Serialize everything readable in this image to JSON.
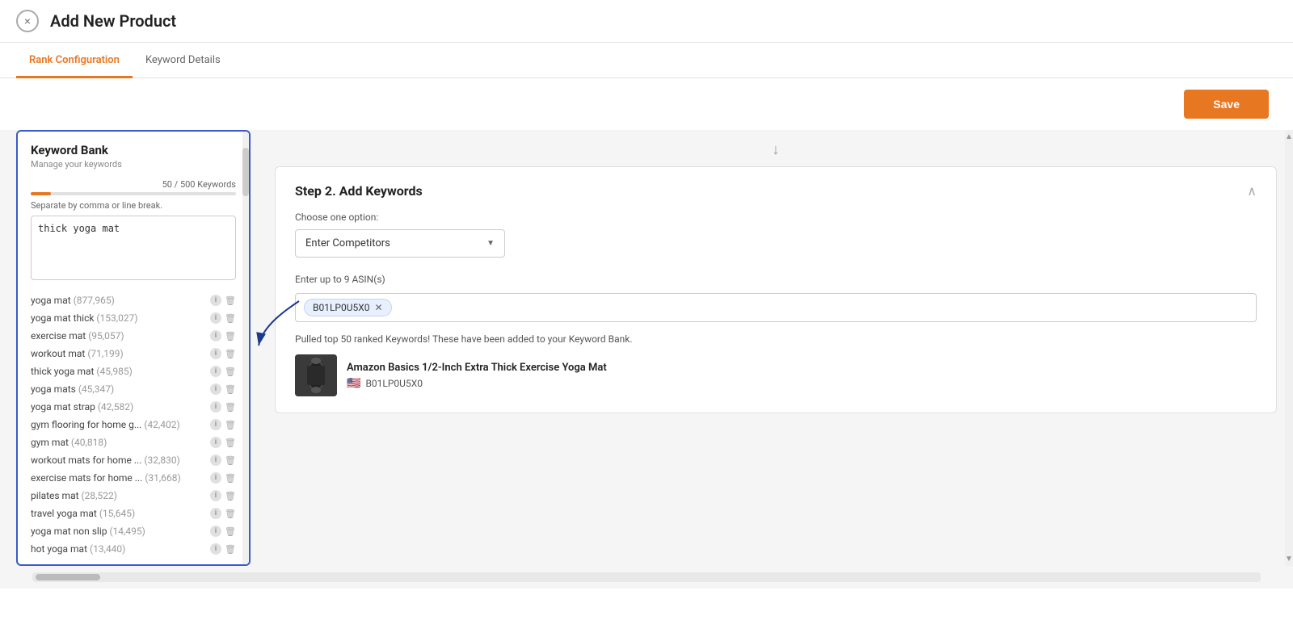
{
  "header": {
    "title": "Add New Product",
    "close_label": "×"
  },
  "tabs": [
    {
      "id": "rank-config",
      "label": "Rank Configuration",
      "active": true
    },
    {
      "id": "keyword-details",
      "label": "Keyword Details",
      "active": false
    }
  ],
  "toolbar": {
    "save_label": "Save"
  },
  "keyword_bank": {
    "title": "Keyword Bank",
    "subtitle": "Manage your keywords",
    "count_text": "50 / 500 Keywords",
    "separator_hint": "Separate by comma or line break.",
    "textarea_value": "thick yoga mat",
    "keywords": [
      {
        "name": "yoga mat",
        "count": "877,965"
      },
      {
        "name": "yoga mat thick",
        "count": "153,027"
      },
      {
        "name": "exercise mat",
        "count": "95,057"
      },
      {
        "name": "workout mat",
        "count": "71,199"
      },
      {
        "name": "thick yoga mat",
        "count": "45,985"
      },
      {
        "name": "yoga mats",
        "count": "45,347"
      },
      {
        "name": "yoga mat strap",
        "count": "42,582"
      },
      {
        "name": "gym flooring for home g...",
        "count": "42,402"
      },
      {
        "name": "gym mat",
        "count": "40,818"
      },
      {
        "name": "workout mats for home ...",
        "count": "32,830"
      },
      {
        "name": "exercise mats for home ...",
        "count": "31,668"
      },
      {
        "name": "pilates mat",
        "count": "28,522"
      },
      {
        "name": "travel yoga mat",
        "count": "15,645"
      },
      {
        "name": "yoga mat non slip",
        "count": "14,495"
      },
      {
        "name": "hot yoga mat",
        "count": "13,440"
      }
    ]
  },
  "step2": {
    "title": "Step 2. Add Keywords",
    "choose_option_label": "Choose one option:",
    "dropdown_value": "Enter Competitors",
    "asin_label": "Enter up to 9 ASIN(s)",
    "asin_tag": "B01LP0U5X0",
    "success_message": "Pulled top 50 ranked Keywords! These have been added to your Keyword Bank.",
    "product": {
      "name": "Amazon Basics 1/2-Inch Extra Thick Exercise Yoga Mat",
      "asin": "B01LP0U5X0",
      "flag": "🇺🇸"
    }
  }
}
